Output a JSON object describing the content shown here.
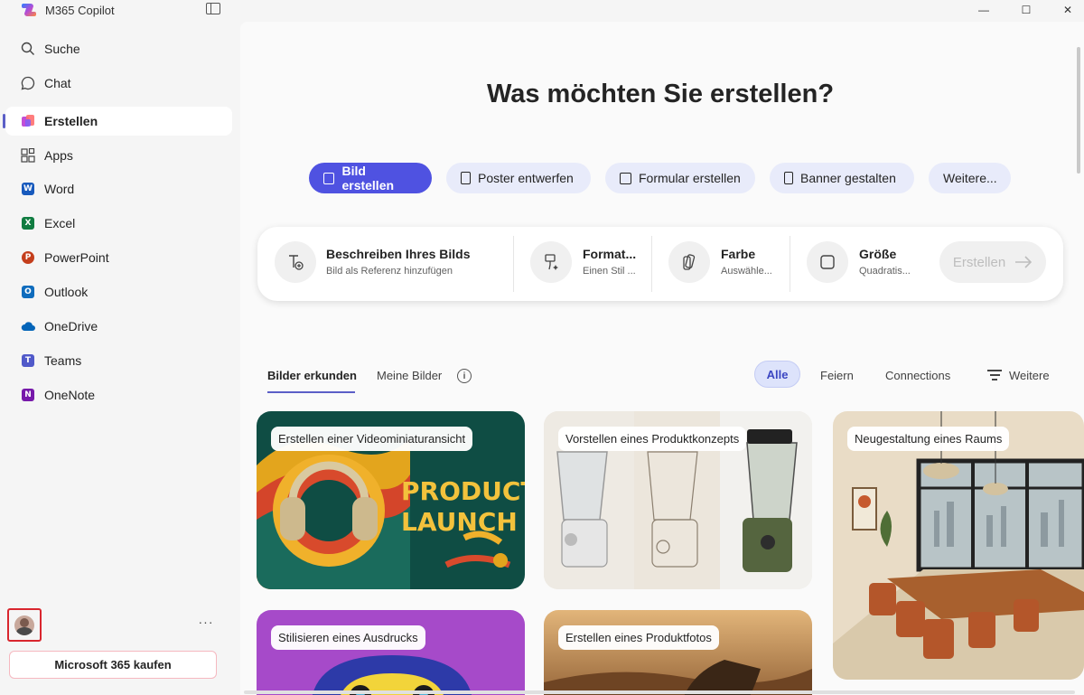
{
  "window": {
    "title": "M365 Copilot",
    "controls": {
      "minimize": "—",
      "maximize": "☐",
      "close": "✕"
    }
  },
  "sidebar": {
    "items": [
      {
        "label": "Suche",
        "icon": "search-icon"
      },
      {
        "label": "Chat",
        "icon": "chat-icon"
      },
      {
        "label": "Erstellen",
        "icon": "create-icon",
        "active": true
      },
      {
        "label": "Apps",
        "icon": "apps-icon"
      },
      {
        "label": "Word",
        "icon": "word-icon",
        "letter": "W",
        "color": "#185abd"
      },
      {
        "label": "Excel",
        "icon": "excel-icon",
        "letter": "X",
        "color": "#107c41"
      },
      {
        "label": "PowerPoint",
        "icon": "powerpoint-icon",
        "letter": "P",
        "color": "#c43e1c"
      },
      {
        "label": "Outlook",
        "icon": "outlook-icon",
        "letter": "O",
        "color": "#0f6cbd"
      },
      {
        "label": "OneDrive",
        "icon": "onedrive-icon",
        "color": "#0364b8"
      },
      {
        "label": "Teams",
        "icon": "teams-icon",
        "letter": "T",
        "color": "#5059c9"
      },
      {
        "label": "OneNote",
        "icon": "onenote-icon",
        "letter": "N",
        "color": "#7719aa"
      }
    ],
    "more": "···",
    "buy_button": "Microsoft 365 kaufen"
  },
  "main": {
    "headline": "Was möchten Sie erstellen?",
    "pills": [
      {
        "label": "Bild erstellen",
        "icon": "image-icon",
        "active": true
      },
      {
        "label": "Poster entwerfen",
        "icon": "poster-icon"
      },
      {
        "label": "Formular erstellen",
        "icon": "form-icon"
      },
      {
        "label": "Banner gestalten",
        "icon": "banner-icon"
      },
      {
        "label": "Weitere...",
        "icon": ""
      }
    ],
    "prompt": {
      "describe": {
        "title": "Beschreiben Ihres Bilds",
        "sub": "Bild als Referenz hinzufügen"
      },
      "format": {
        "title": "Format...",
        "sub": "Einen Stil ..."
      },
      "color": {
        "title": "Farbe",
        "sub": "Auswähle..."
      },
      "size": {
        "title": "Größe",
        "sub": "Quadratis..."
      },
      "create_button": "Erstellen"
    },
    "tabs": [
      {
        "label": "Bilder erkunden",
        "active": true
      },
      {
        "label": "Meine Bilder"
      }
    ],
    "info": "i",
    "filters": [
      "Alle",
      "Feiern",
      "Connections"
    ],
    "filter_more": "Weitere",
    "cards": [
      {
        "label": "Erstellen einer Videominiaturansicht",
        "art_text": [
          "PRODUCT",
          "LAUNCH"
        ]
      },
      {
        "label": "Vorstellen eines Produktkonzepts"
      },
      {
        "label": "Neugestaltung eines Raums"
      },
      {
        "label": "Stilisieren eines Ausdrucks"
      },
      {
        "label": "Erstellen eines Produktfotos"
      }
    ]
  },
  "colors": {
    "accent": "#4f52e1",
    "active_bar": "#5b5fc7",
    "highlight_red": "#d9262e"
  }
}
